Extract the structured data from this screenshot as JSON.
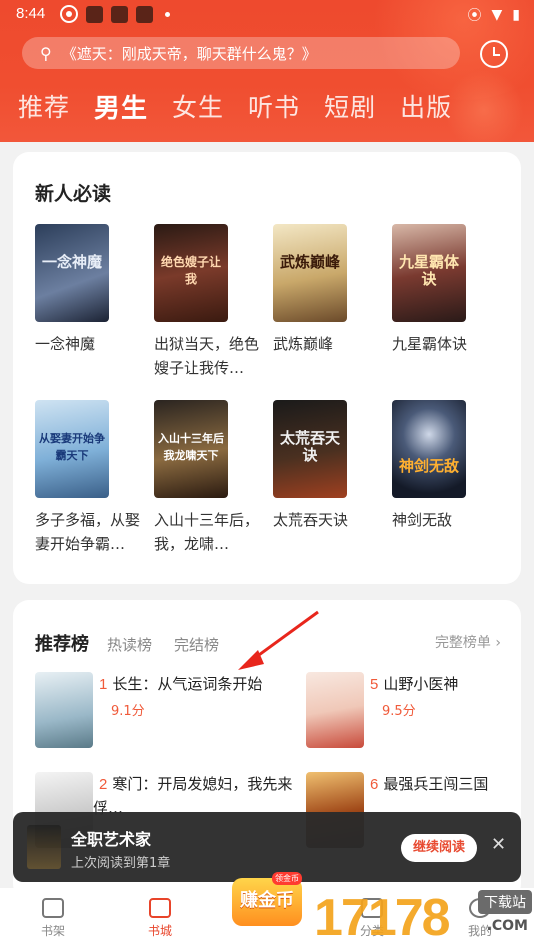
{
  "status_bar": {
    "time": "8:44"
  },
  "search": {
    "placeholder": "《遮天：刚成天帝，聊天群什么鬼？》"
  },
  "tabs": [
    {
      "label": "推荐",
      "active": false
    },
    {
      "label": "男生",
      "active": true
    },
    {
      "label": "女生",
      "active": false
    },
    {
      "label": "听书",
      "active": false
    },
    {
      "label": "短剧",
      "active": false
    },
    {
      "label": "出版",
      "active": false
    }
  ],
  "new_reader": {
    "title": "新人必读",
    "books": [
      {
        "name": "一念神魔",
        "cover_text": "一念神魔"
      },
      {
        "name": "出狱当天，绝色嫂子让我传…",
        "cover_text": "绝色嫂子让我"
      },
      {
        "name": "武炼巅峰",
        "cover_text": "武炼巅峰"
      },
      {
        "name": "九星霸体诀",
        "cover_text": "九星霸体诀"
      },
      {
        "name": "多子多福，从娶妻开始争霸…",
        "cover_text": "从娶妻开始争霸天下"
      },
      {
        "name": "入山十三年后，我，龙啸…",
        "cover_text": "入山十三年后我龙啸天下"
      },
      {
        "name": "太荒吞天诀",
        "cover_text": "太荒吞天诀"
      },
      {
        "name": "神剑无敌",
        "cover_text": "神剑无敌"
      }
    ]
  },
  "ranking": {
    "title": "推荐榜",
    "subtabs": [
      "热读榜",
      "完结榜"
    ],
    "full_list": "完整榜单 ›",
    "items": [
      {
        "rank": "1",
        "title": "长生：从气运词条开始",
        "score": "9.1分"
      },
      {
        "rank": "5",
        "title": "山野小医神",
        "score": "9.5分"
      },
      {
        "rank": "2",
        "title": "寒门：开局发媳妇，我先来俘…",
        "score": ""
      },
      {
        "rank": "6",
        "title": "最强兵王闯三国",
        "score": ""
      }
    ]
  },
  "continue_reading": {
    "title": "全职艺术家",
    "subtitle": "上次阅读到第1章",
    "button": "继续阅读",
    "close": "✕"
  },
  "bottom_nav": {
    "items": [
      "书架",
      "书城",
      "分类",
      "我的"
    ],
    "coin_label": "赚金币",
    "coin_tag": "领金币"
  },
  "watermark": {
    "text": "17178",
    "badge": "下载站",
    "suffix": ".COM"
  },
  "colors": {
    "accent": "#ee4a2e",
    "score": "#f05a3a"
  }
}
